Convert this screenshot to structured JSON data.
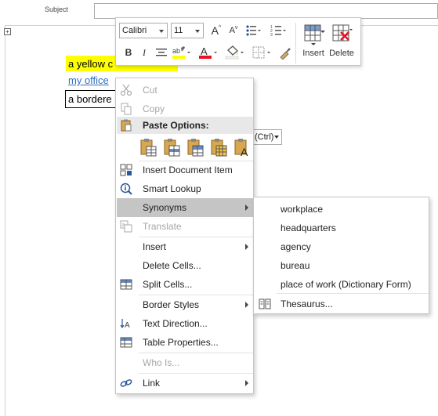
{
  "header": {
    "subject_label": "Subject",
    "subject_value": ""
  },
  "document": {
    "line1": "a yellow c",
    "line2": "my office",
    "line3": "a bordere",
    "paste_tag": "(Ctrl)"
  },
  "mini_toolbar": {
    "font_name": "Calibri",
    "font_size": "11",
    "insert_label": "Insert",
    "delete_label": "Delete",
    "bold": "B",
    "italic": "I",
    "grow_font": "A",
    "shrink_font": "A",
    "font_color_glyph": "A"
  },
  "context_menu": {
    "items": [
      {
        "label": "Cut",
        "enabled": false
      },
      {
        "label": "Copy",
        "enabled": false
      },
      {
        "label": "Paste Options:",
        "header": true
      },
      {
        "label": "Insert Document Item",
        "enabled": true
      },
      {
        "label": "Smart Lookup",
        "enabled": true
      },
      {
        "label": "Synonyms",
        "enabled": true,
        "submenu": true,
        "highlighted": true
      },
      {
        "label": "Translate",
        "enabled": false
      },
      {
        "label": "Insert",
        "enabled": true,
        "submenu": true
      },
      {
        "label": "Delete Cells...",
        "enabled": true
      },
      {
        "label": "Split Cells...",
        "enabled": true
      },
      {
        "label": "Border Styles",
        "enabled": true,
        "submenu": true
      },
      {
        "label": "Text Direction...",
        "enabled": true
      },
      {
        "label": "Table Properties...",
        "enabled": true
      },
      {
        "label": "Who Is...",
        "enabled": false
      },
      {
        "label": "Link",
        "enabled": true,
        "submenu": true
      }
    ]
  },
  "synonyms_submenu": {
    "items": [
      "workplace",
      "headquarters",
      "agency",
      "bureau",
      "place of work (Dictionary Form)"
    ],
    "thesaurus": "Thesaurus..."
  },
  "colors": {
    "highlight": "#ffff00",
    "link": "#2e6fc0",
    "font_color": "#e81123",
    "menu_hover": "#c5c5c5",
    "disabled_text": "#a6a6a6"
  }
}
